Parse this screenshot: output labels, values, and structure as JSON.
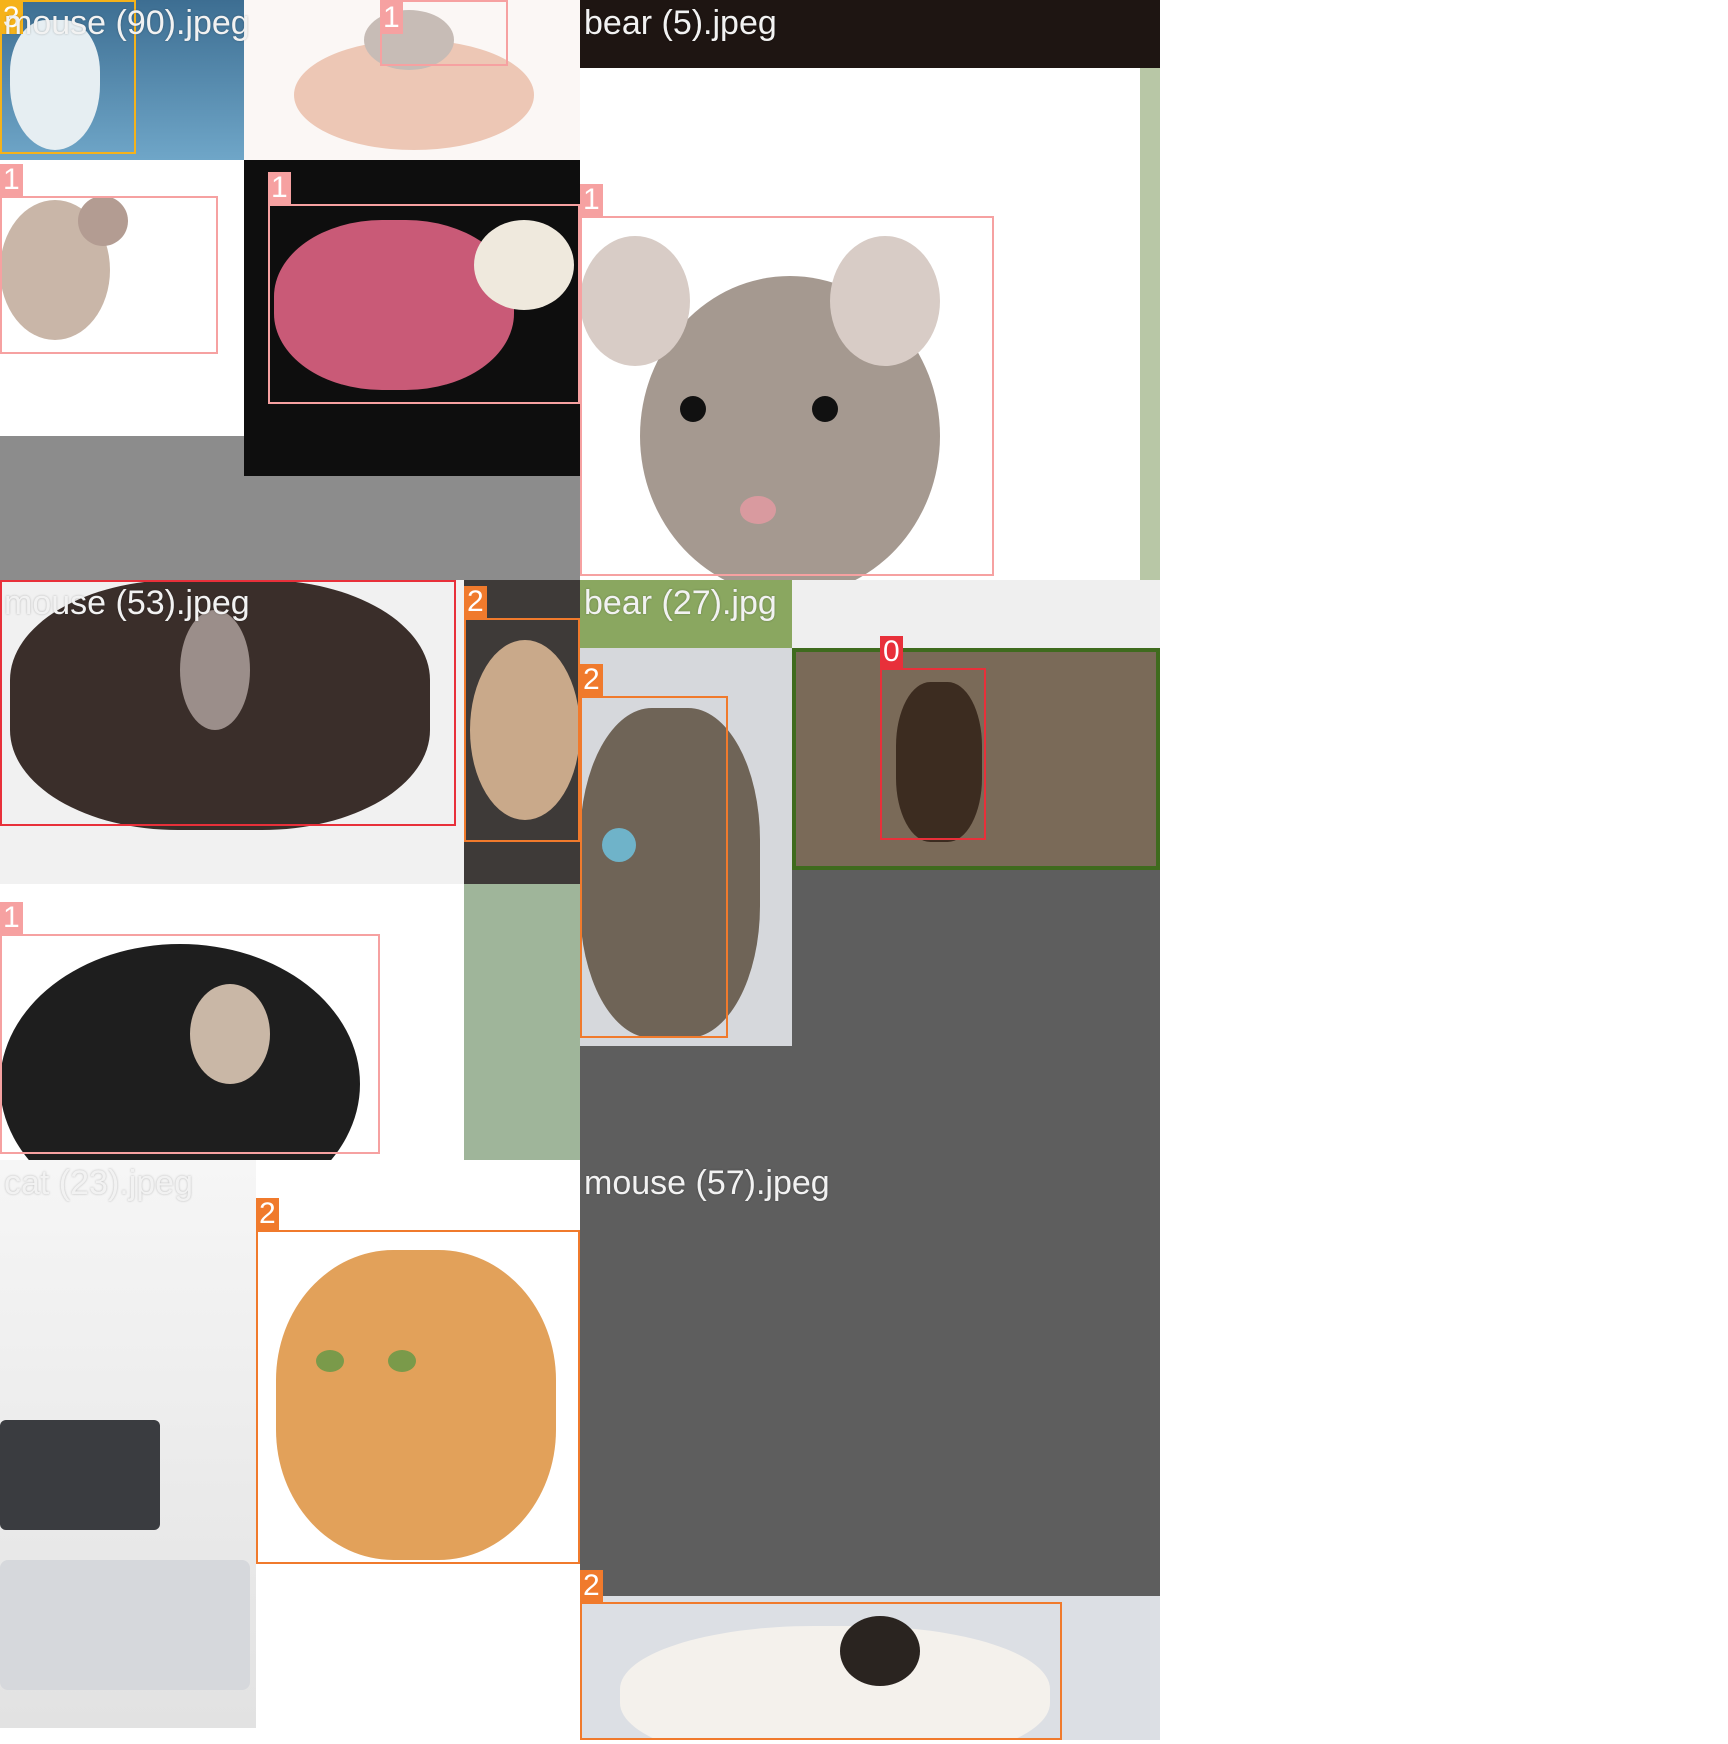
{
  "tiles": [
    {
      "filename": "mouse (90).jpeg"
    },
    {
      "filename": "bear (5).jpeg"
    },
    {
      "filename": "mouse (53).jpeg"
    },
    {
      "filename": "bear (27).jpg"
    },
    {
      "filename": "cat (23).jpeg"
    },
    {
      "filename": "mouse (57).jpeg"
    }
  ],
  "labels": {
    "cls0": "0",
    "cls1": "1",
    "cls2": "2",
    "cls3": "3"
  },
  "colors": {
    "class_0": "#e8303a",
    "class_1": "#f6a1a1",
    "class_2": "#f07a2c",
    "class_3": "#f5b21a",
    "empty_area": "#8c8c8c",
    "empty_area_dark": "#5e5e5e"
  }
}
